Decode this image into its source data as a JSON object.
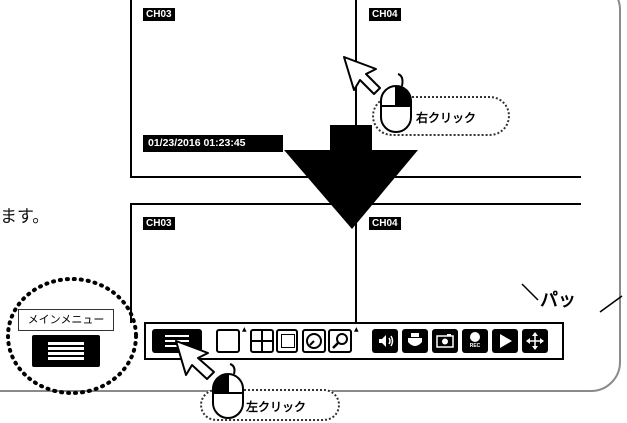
{
  "screen": {
    "top_channels": [
      "CH03",
      "CH04"
    ],
    "bottom_channels": [
      "CH03",
      "CH04"
    ],
    "timestamp": "01/23/2016 01:23:45"
  },
  "side_text": "ます。",
  "callouts": {
    "right_click": "右クリック",
    "left_click": "左クリック",
    "pop_sound": "パッ"
  },
  "main_menu": {
    "label": "メインメニュー",
    "icon": "menu-list-icon"
  },
  "toolbar": {
    "rec_label": "REC",
    "buttons": [
      "menu-icon",
      "single-view-icon",
      "quad-view-icon",
      "playback-search-icon",
      "zoom-icon",
      "volume-icon",
      "ptz-icon",
      "snapshot-icon",
      "record-icon",
      "play-icon",
      "move-arrows-icon"
    ]
  },
  "colors": {
    "frame": "#8a8a8a",
    "dark": "#000000",
    "accent": "#ffffff"
  }
}
